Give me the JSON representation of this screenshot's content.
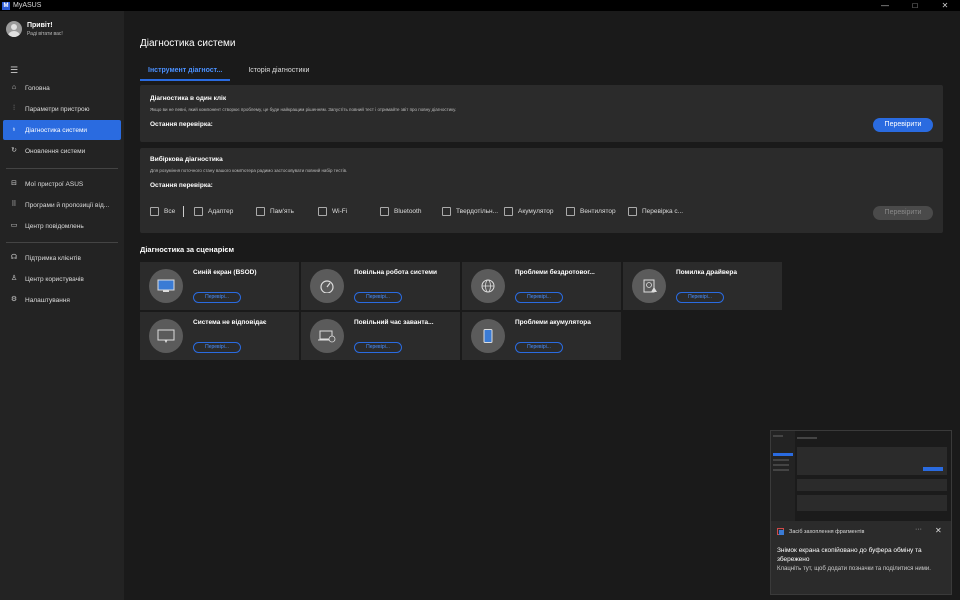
{
  "app": {
    "title": "MyASUS",
    "logo": "M"
  },
  "window_controls": {
    "minimize": "—",
    "maximize": "□",
    "close": "✕"
  },
  "profile": {
    "greeting": "Привіт!",
    "subtitle": "Раді вітати вас!"
  },
  "sidebar": {
    "menu_icon": "☰",
    "items": [
      {
        "label": "Головна",
        "icon": "home-icon",
        "glyph": "⌂"
      },
      {
        "label": "Параметри пристрою",
        "icon": "sliders-icon",
        "glyph": "⫶"
      },
      {
        "label": "Діагностика системи",
        "icon": "stethoscope-icon",
        "glyph": "♁"
      },
      {
        "label": "Оновлення системи",
        "icon": "refresh-icon",
        "glyph": "↻"
      },
      {
        "label": "Мої пристрої ASUS",
        "icon": "devices-icon",
        "glyph": "⊟"
      },
      {
        "label": "Програми й пропозиції від...",
        "icon": "apps-icon",
        "glyph": "⠿"
      },
      {
        "label": "Центр повідомлень",
        "icon": "message-icon",
        "glyph": "▭"
      },
      {
        "label": "Підтримка клієнтів",
        "icon": "headset-icon",
        "glyph": "☊"
      },
      {
        "label": "Центр користувачів",
        "icon": "user-icon",
        "glyph": "♙"
      },
      {
        "label": "Налаштування",
        "icon": "gear-icon",
        "glyph": "⚙"
      }
    ]
  },
  "main": {
    "title": "Діагностика системи",
    "tabs": [
      {
        "label": "Інструмент діагност..."
      },
      {
        "label": "Історія діагностики"
      }
    ],
    "one_click": {
      "title": "Діагностика в один клік",
      "desc": "Якщо ви не певні, який компонент створює проблему, це буде найкращим рішенням. Запустіть повний тест і отримайте звіт про повну діагностику.",
      "last": "Остання перевірка:",
      "button": "Перевірити"
    },
    "selective": {
      "title": "Вибіркова діагностика",
      "desc": "Для розуміння поточного стану вашого комп'ютера радимо застосовувати повний набір тестів.",
      "last": "Остання перевірка:",
      "checks": [
        "Все",
        "Адаптер",
        "Пам'ять",
        "Wi-Fi",
        "Bluetooth",
        "Твердотільн...",
        "Акумулятор",
        "Вентилятор",
        "Перевірка с..."
      ],
      "button": "Перевірити"
    },
    "scenarios_title": "Діагностика за сценарієм",
    "scenarios": [
      {
        "label": "Синій екран (BSOD)",
        "button": "Перевірі...",
        "icon": "bsod-monitor-icon"
      },
      {
        "label": "Повільна робота системи",
        "button": "Перевірі...",
        "icon": "speedometer-icon"
      },
      {
        "label": "Проблеми бездротовог...",
        "button": "Перевірі...",
        "icon": "globe-icon"
      },
      {
        "label": "Помилка драйвера",
        "button": "Перевірі...",
        "icon": "driver-warning-icon"
      },
      {
        "label": "Система не відповідає",
        "button": "Перевірі...",
        "icon": "frozen-screen-icon"
      },
      {
        "label": "Повільний час заванта...",
        "button": "Перевірі...",
        "icon": "laptop-clock-icon"
      },
      {
        "label": "Проблеми акумулятора",
        "button": "Перевірі...",
        "icon": "phone-battery-icon"
      }
    ]
  },
  "toast": {
    "app": "Засіб захоплення фрагментів",
    "more": "···",
    "close": "✕",
    "message": "Знімок екрана скопійовано до буфера обміну та збережено",
    "hint": "Клацніть тут, щоб додати позначки та поділитися ними."
  }
}
